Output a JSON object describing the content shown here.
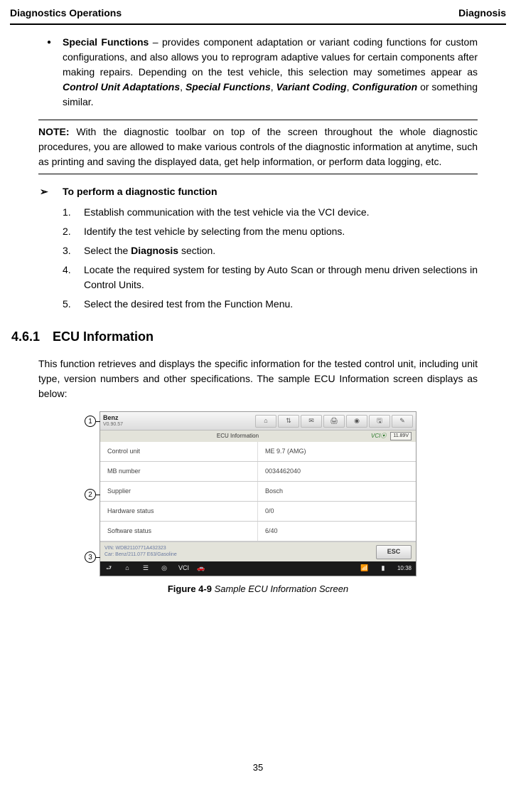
{
  "header": {
    "left": "Diagnostics Operations",
    "right": "Diagnosis"
  },
  "special": {
    "title": "Special Functions",
    "sep": " – ",
    "body1": "provides component adaptation or variant coding functions for custom configurations, and also allows you to reprogram adaptive values for certain components after making repairs. Depending on the test vehicle, this selection may sometimes appear as ",
    "terms": [
      "Control Unit Adaptations",
      "Special Functions",
      "Variant Coding",
      "Configuration"
    ],
    "body2": " or something similar."
  },
  "note": {
    "label": "NOTE:",
    "text": " With the diagnostic toolbar on top of the screen throughout the whole diagnostic procedures, you are allowed to make various controls of the diagnostic information at anytime, such as printing and saving the displayed data, get help information, or perform data logging, etc."
  },
  "procedure": {
    "arrow": "➢",
    "title": "To perform a diagnostic function",
    "steps": [
      {
        "n": "1.",
        "t": "Establish communication with the test vehicle via the VCI device."
      },
      {
        "n": "2.",
        "t": "Identify the test vehicle by selecting from the menu options."
      },
      {
        "n": "3.",
        "pre": "Select the ",
        "bold": "Diagnosis",
        "post": " section."
      },
      {
        "n": "4.",
        "t": "Locate the required system for testing by Auto Scan or through menu driven selections in Control Units."
      },
      {
        "n": "5.",
        "t": "Select the desired test from the Function Menu."
      }
    ]
  },
  "section": {
    "num": "4.6.1",
    "title": "ECU Information"
  },
  "intro": "This function retrieves and displays the specific information for the tested control unit, including unit type, version numbers and other specifications. The sample ECU Information screen displays as below:",
  "figure": {
    "brand": "Benz",
    "version": "V0.90.57",
    "toolbar_icons": [
      "⌂",
      "⇅",
      "✉",
      "🖨",
      "◉",
      "🖫",
      "✎"
    ],
    "subtitle": "ECU Information",
    "vci": "VCI",
    "battery": "11.89V",
    "rows": [
      {
        "k": "Control unit",
        "v": "ME 9.7 (AMG)"
      },
      {
        "k": "MB number",
        "v": "0034462040"
      },
      {
        "k": "Supplier",
        "v": "Bosch"
      },
      {
        "k": "Hardware status",
        "v": "0/0"
      },
      {
        "k": "Software status",
        "v": "6/40"
      }
    ],
    "vin_line1": "VIN: WDB2110771A432323",
    "vin_line2": "Car: Benz/211.077 E63/Gasoline",
    "esc": "ESC",
    "nav_icons": [
      "⮐",
      "⌂",
      "☰",
      "◎",
      "VCI",
      "🚗"
    ],
    "nav_right": [
      "📶",
      "▮",
      "10:38"
    ],
    "callouts": [
      "1",
      "2",
      "3"
    ],
    "caption_label": "Figure 4-9",
    "caption_text": " Sample ECU Information Screen"
  },
  "page": "35"
}
